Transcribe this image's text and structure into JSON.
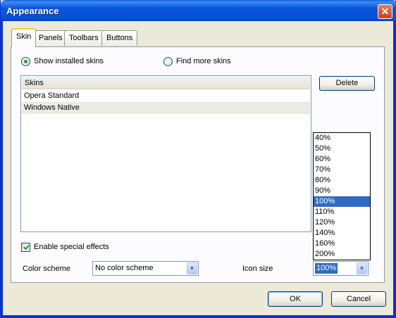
{
  "window": {
    "title": "Appearance",
    "close_glyph": "✕"
  },
  "tabs": [
    {
      "label": "Skin",
      "active": true
    },
    {
      "label": "Panels",
      "active": false
    },
    {
      "label": "Toolbars",
      "active": false
    },
    {
      "label": "Buttons",
      "active": false
    }
  ],
  "skin_source": {
    "installed_label": "Show installed skins",
    "find_more_label": "Find more skins",
    "selected": "installed"
  },
  "skins_list": {
    "header": "Skins",
    "rows": [
      "Opera Standard",
      "Windows Native"
    ],
    "selected_index": 1
  },
  "delete_button": "Delete",
  "special_effects": {
    "label": "Enable special effects",
    "checked": true
  },
  "color_scheme": {
    "label": "Color scheme",
    "value": "No color scheme"
  },
  "icon_size": {
    "label": "Icon size",
    "value": "100%",
    "options": [
      "40%",
      "50%",
      "60%",
      "70%",
      "80%",
      "90%",
      "100%",
      "110%",
      "120%",
      "140%",
      "160%",
      "200%"
    ]
  },
  "footer": {
    "ok": "OK",
    "cancel": "Cancel"
  },
  "colors": {
    "titlebar": "#0a4fd2",
    "accent_tab": "#ffc83c",
    "selection": "#316ac5",
    "check": "#21a121"
  }
}
